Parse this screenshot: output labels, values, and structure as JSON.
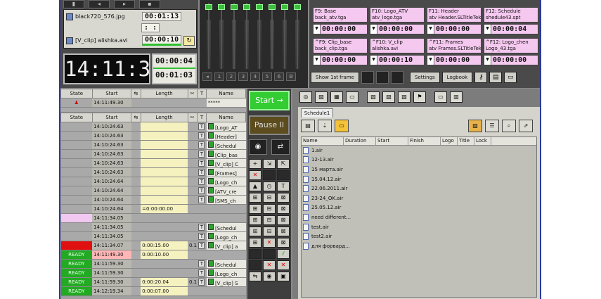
{
  "preview": {
    "clip1_name": "black720_576.jpg",
    "clip1_tc": "00:01:13",
    "clip1_tc2": ":   :",
    "clip2_name": "[V_clip] alishka.avi",
    "clip2_tc": "00:00:10"
  },
  "clock": {
    "time": "14:11:38",
    "tc_a": "00:00:04",
    "tc_b": "00:01:03"
  },
  "mixer": {
    "numbers": [
      "1",
      "2",
      "3",
      "4",
      "5",
      "6"
    ]
  },
  "fkeys": [
    {
      "label1": "F9: Base",
      "label2": "back_atv.tga",
      "tc": "00:00:00"
    },
    {
      "label1": "F10: Logo_ATV",
      "label2": "atv_logo.tga",
      "tc": "00:00:00"
    },
    {
      "label1": "F11: Header",
      "label2": "atv Header.SLTitleTek",
      "tc": "00:00:00"
    },
    {
      "label1": "F12: Schedule",
      "label2": "shedule43.spt",
      "tc": "00:00:04"
    },
    {
      "label1": "^F9: Clip_base",
      "label2": "back_clip.tga",
      "tc": "00:00:00"
    },
    {
      "label1": "^F10: V_clip",
      "label2": "alishka.avi",
      "tc": "00:00:10"
    },
    {
      "label1": "^F11: Frames",
      "label2": "atv Frames.SLTitleTek",
      "tc": "00:00:00"
    },
    {
      "label1": "^F12: Logo_chen",
      "label2": "Logo_43.tga",
      "tc": "00:00:00"
    }
  ],
  "topbar": {
    "show_1st": "Show 1st frame",
    "settings": "Settings",
    "logbook": "Logbook"
  },
  "columns": {
    "state": "State",
    "start": "Start",
    "length": "Length",
    "name": "Name"
  },
  "top_table": {
    "rows": [
      {
        "start": "14:11:49.30",
        "name": "*****"
      }
    ]
  },
  "main_table": {
    "rows": [
      {
        "state": "",
        "start": "14:10:24.63",
        "length": "",
        "x": "",
        "name": "[Logo_AT"
      },
      {
        "state": "",
        "start": "14:10:24.63",
        "length": "",
        "x": "",
        "name": "[Header]"
      },
      {
        "state": "",
        "start": "14:10:24.63",
        "length": "",
        "x": "",
        "name": "[Schedul"
      },
      {
        "state": "",
        "start": "14:10:24.63",
        "length": "",
        "x": "",
        "name": "[Clip_bas"
      },
      {
        "state": "",
        "start": "14:10:24.63",
        "length": "",
        "x": "",
        "name": "[V_clip] C"
      },
      {
        "state": "",
        "start": "14:10:24.63",
        "length": "",
        "x": "",
        "name": "[Frames]"
      },
      {
        "state": "",
        "start": "14:10:24.64",
        "length": "",
        "x": "",
        "name": "[Logo_ch"
      },
      {
        "state": "",
        "start": "14:10:24.64",
        "length": "",
        "x": "",
        "name": "[ATV_cre"
      },
      {
        "state": "",
        "start": "14:10:24.64",
        "length": "",
        "x": "",
        "name": "[SMS_ch"
      },
      {
        "state": "",
        "start": "14:10:24.64",
        "length": "=0:00:00.00",
        "x": "",
        "name": ""
      },
      {
        "state": "",
        "start": "14:11:34.05",
        "length": "",
        "x": "",
        "name": ""
      },
      {
        "state": "",
        "start": "14:11:34.05",
        "length": "",
        "x": "",
        "name": "[Schedul"
      },
      {
        "state": "",
        "start": "14:11:34.05",
        "length": "",
        "x": "",
        "name": "[Logo_ch"
      },
      {
        "state": "",
        "start": "14:11:34.07",
        "length": "0:00:15.00",
        "x": "0.10",
        "name": "[V_clip] a"
      },
      {
        "state": "READY",
        "start": "14:11:49.30",
        "length": "0:00:10.00",
        "x": "",
        "name": ""
      },
      {
        "state": "READY",
        "start": "14:11:59.30",
        "length": "",
        "x": "",
        "name": "[Schedul"
      },
      {
        "state": "READY",
        "start": "14:11:59.30",
        "length": "",
        "x": "",
        "name": "[Logo_ch"
      },
      {
        "state": "READY",
        "start": "14:11:59.30",
        "length": "0:00:20.04",
        "x": "0.10",
        "name": "[V_clip] S"
      },
      {
        "state": "READY",
        "start": "14:12:19.34",
        "length": "0:00:07.00",
        "x": "",
        "name": ""
      }
    ]
  },
  "controls": {
    "start": "Start",
    "start_glyph": "→",
    "pause": "Pause",
    "pause_glyph": "II"
  },
  "schedule": {
    "tab": "Schedule1",
    "headers": [
      "Name",
      "Duration",
      "Start",
      "Finish",
      "Logo",
      "Title",
      "Lock"
    ],
    "files": [
      "1.air",
      "12-13.air",
      "15 марта.air",
      "15.04.12.air",
      "22.06.2011.air",
      "23-24_OK.air",
      "25.05.12.air",
      "need different...",
      "test.air",
      "test2.air",
      "для форвард..."
    ]
  }
}
